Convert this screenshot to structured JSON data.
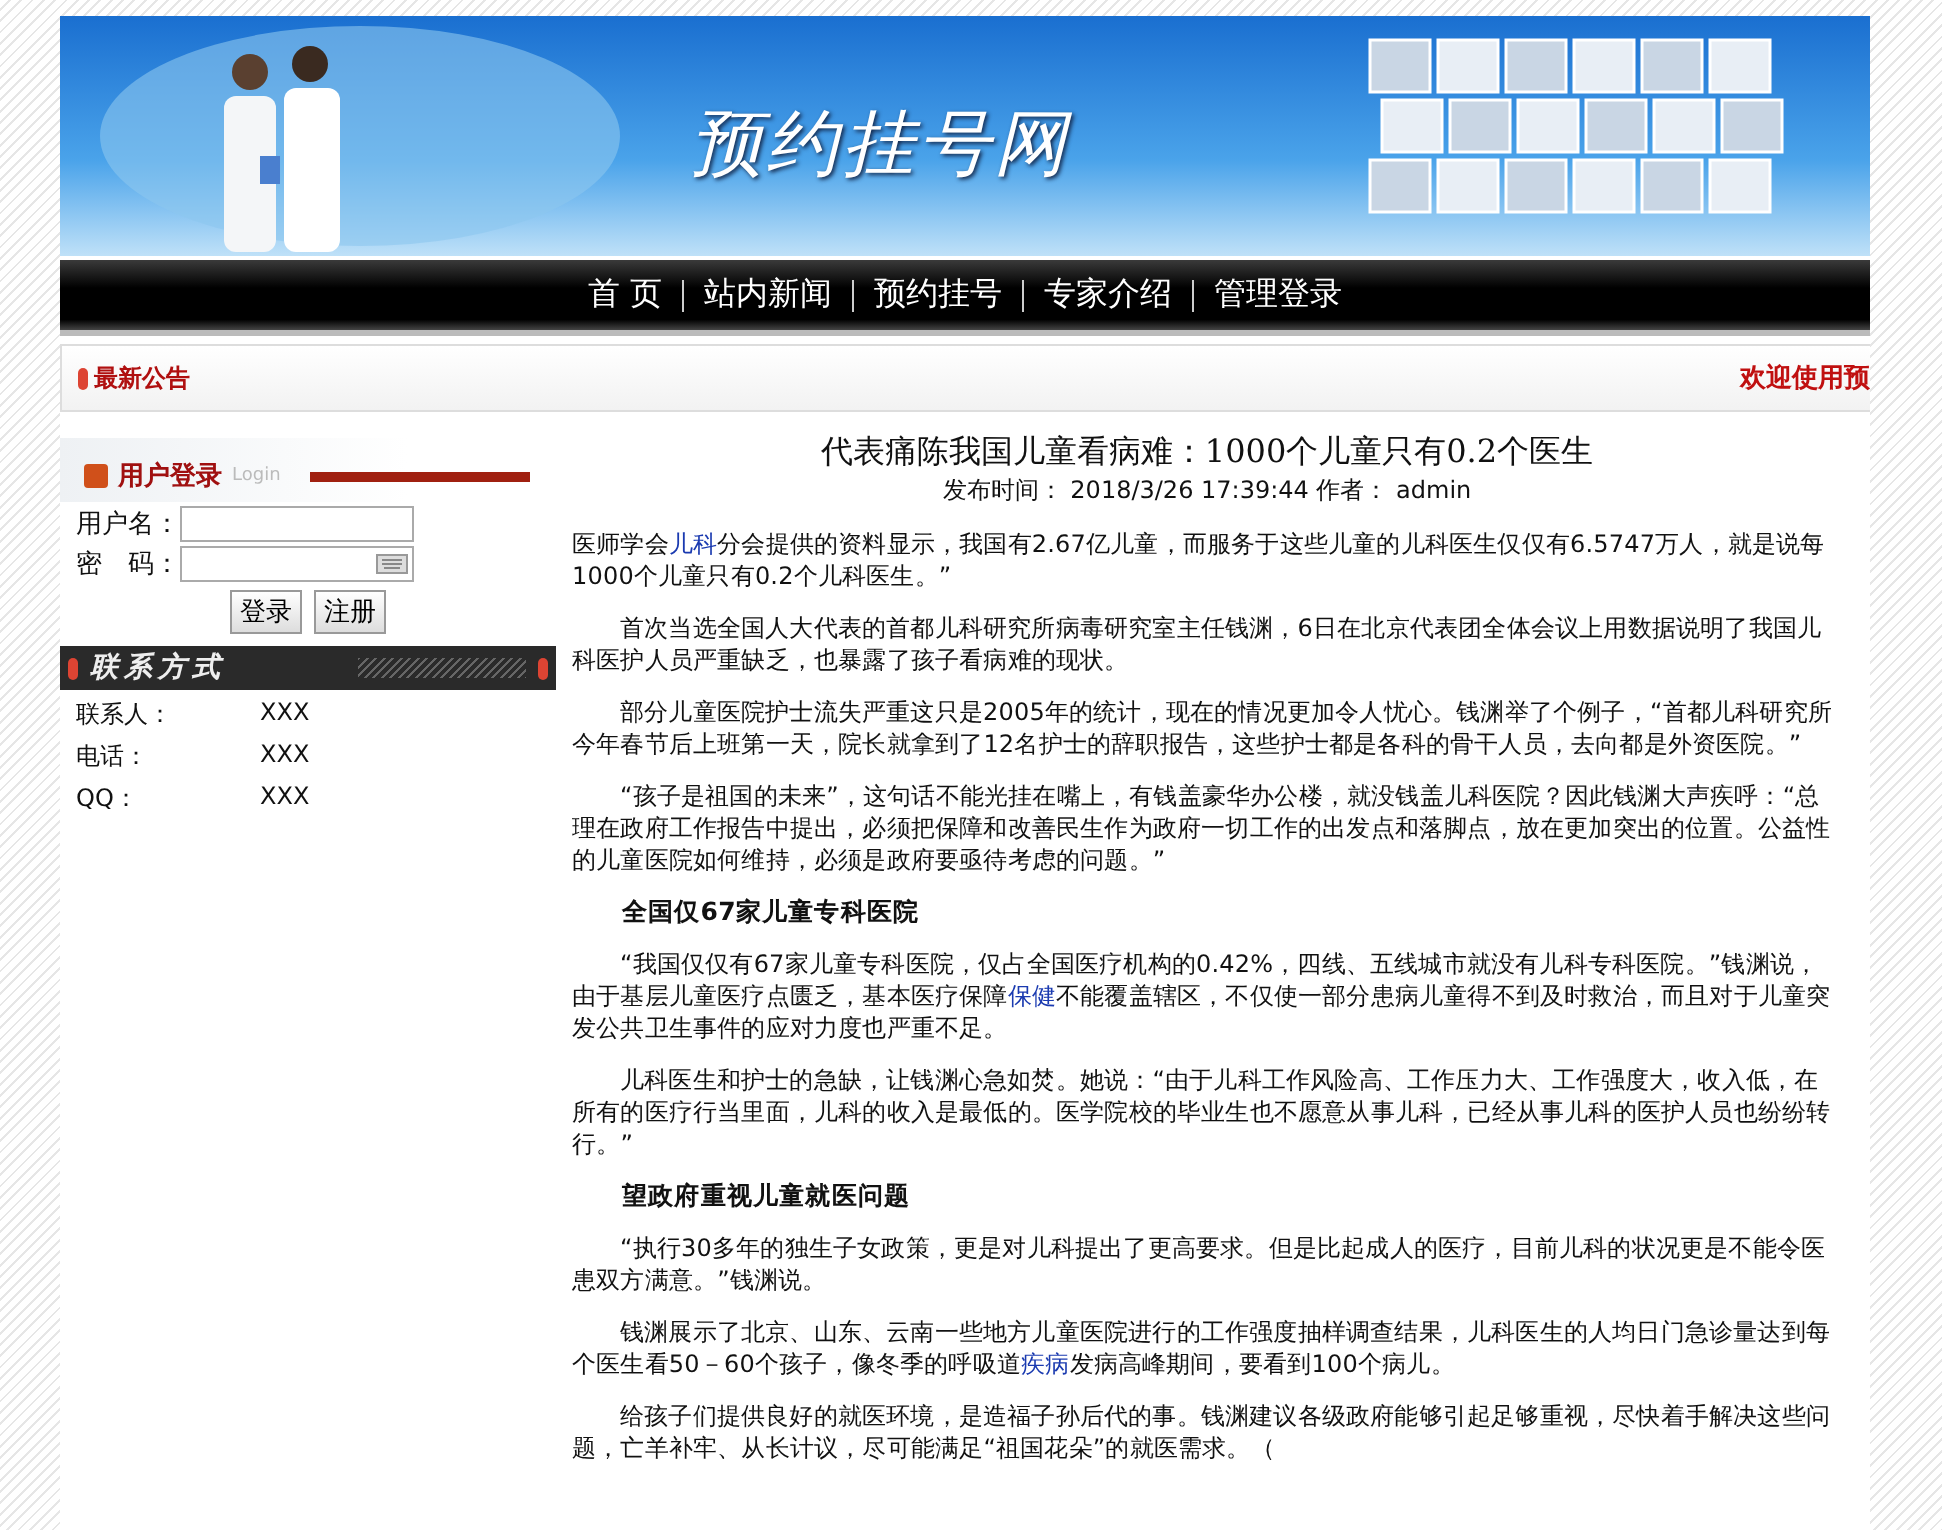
{
  "banner": {
    "title": "预约挂号网"
  },
  "nav": [
    {
      "label": "首 页"
    },
    {
      "label": "站内新闻"
    },
    {
      "label": "预约挂号"
    },
    {
      "label": "专家介绍"
    },
    {
      "label": "管理登录"
    }
  ],
  "notice": {
    "label": "最新公告",
    "text": "欢迎使用预"
  },
  "login": {
    "title": "用户登录",
    "subtitle": "Login",
    "username_label": "用户名：",
    "password_label": "密　码：",
    "buttons": [
      "登录",
      "注册"
    ]
  },
  "contact": {
    "title": "联系方式",
    "rows": [
      {
        "label": "联系人：",
        "value": "XXX"
      },
      {
        "label": "电话：",
        "value": "XXX"
      },
      {
        "label": "QQ：",
        "value": "XXX"
      }
    ]
  },
  "article": {
    "title": "代表痛陈我国儿童看病难：1000个儿童只有0.2个医生",
    "meta": "发布时间：  2018/3/26 17:39:44 作者：  admin",
    "blocks": [
      {
        "kind": "paragraph",
        "indent": false,
        "parts": [
          {
            "text": "医师学会",
            "link": false
          },
          {
            "text": "儿科",
            "link": true
          },
          {
            "text": "分会提供的资料显示，我国有2.67亿儿童，而服务于这些儿童的儿科医生仅仅有6.5747万人，就是说每1000个儿童只有0.2个儿科医生。”",
            "link": false
          }
        ]
      },
      {
        "kind": "paragraph",
        "indent": true,
        "parts": [
          {
            "text": "首次当选全国人大代表的首都儿科研究所病毒研究室主任钱渊，6日在北京代表团全体会议上用数据说明了我国儿科医护人员严重缺乏，也暴露了孩子看病难的现状。",
            "link": false
          }
        ]
      },
      {
        "kind": "paragraph",
        "indent": true,
        "parts": [
          {
            "text": "部分儿童医院护士流失严重这只是2005年的统计，现在的情况更加令人忧心。钱渊举了个例子，“首都儿科研究所今年春节后上班第一天，院长就拿到了12名护士的辞职报告，这些护士都是各科的骨干人员，去向都是外资医院。”",
            "link": false
          }
        ]
      },
      {
        "kind": "paragraph",
        "indent": true,
        "parts": [
          {
            "text": "“孩子是祖国的未来”，这句话不能光挂在嘴上，有钱盖豪华办公楼，就没钱盖儿科医院？因此钱渊大声疾呼：“总理在政府工作报告中提出，必须把保障和改善民生作为政府一切工作的出发点和落脚点，放在更加突出的位置。公益性的儿童医院如何维持，必须是政府要亟待考虑的问题。”",
            "link": false
          }
        ]
      },
      {
        "kind": "heading",
        "indent": true,
        "parts": [
          {
            "text": "全国仅67家儿童专科医院",
            "link": false
          }
        ]
      },
      {
        "kind": "paragraph",
        "indent": true,
        "parts": [
          {
            "text": "“我国仅仅有67家儿童专科医院，仅占全国医疗机构的0.42%，四线、五线城市就没有儿科专科医院。”钱渊说，由于基层儿童医疗点匮乏，基本医疗保障",
            "link": false
          },
          {
            "text": "保健",
            "link": true
          },
          {
            "text": "不能覆盖辖区，不仅使一部分患病儿童得不到及时救治，而且对于儿童突发公共卫生事件的应对力度也严重不足。",
            "link": false
          }
        ]
      },
      {
        "kind": "paragraph",
        "indent": true,
        "parts": [
          {
            "text": "儿科医生和护士的急缺，让钱渊心急如焚。她说：“由于儿科工作风险高、工作压力大、工作强度大，收入低，在所有的医疗行当里面，儿科的收入是最低的。医学院校的毕业生也不愿意从事儿科，已经从事儿科的医护人员也纷纷转行。”",
            "link": false
          }
        ]
      },
      {
        "kind": "heading",
        "indent": true,
        "parts": [
          {
            "text": "望政府重视儿童就医问题",
            "link": false
          }
        ]
      },
      {
        "kind": "paragraph",
        "indent": true,
        "parts": [
          {
            "text": "“执行30多年的独生子女政策，更是对儿科提出了更高要求。但是比起成人的医疗，目前儿科的状况更是不能令医患双方满意。”钱渊说。",
            "link": false
          }
        ]
      },
      {
        "kind": "paragraph",
        "indent": true,
        "parts": [
          {
            "text": "钱渊展示了北京、山东、云南一些地方儿童医院进行的工作强度抽样调查结果，儿科医生的人均日门急诊量达到每个医生看50－60个孩子，像冬季的呼吸道",
            "link": false
          },
          {
            "text": "疾病",
            "link": true
          },
          {
            "text": "发病高峰期间，要看到100个病儿。",
            "link": false
          }
        ]
      },
      {
        "kind": "paragraph",
        "indent": true,
        "parts": [
          {
            "text": "给孩子们提供良好的就医环境，是造福子孙后代的事。钱渊建议各级政府能够引起足够重视，尽快着手解决这些问题，亡羊补牢、从长计议，尽可能满足“祖国花朵”的就医需求。（",
            "link": false
          }
        ]
      }
    ]
  }
}
